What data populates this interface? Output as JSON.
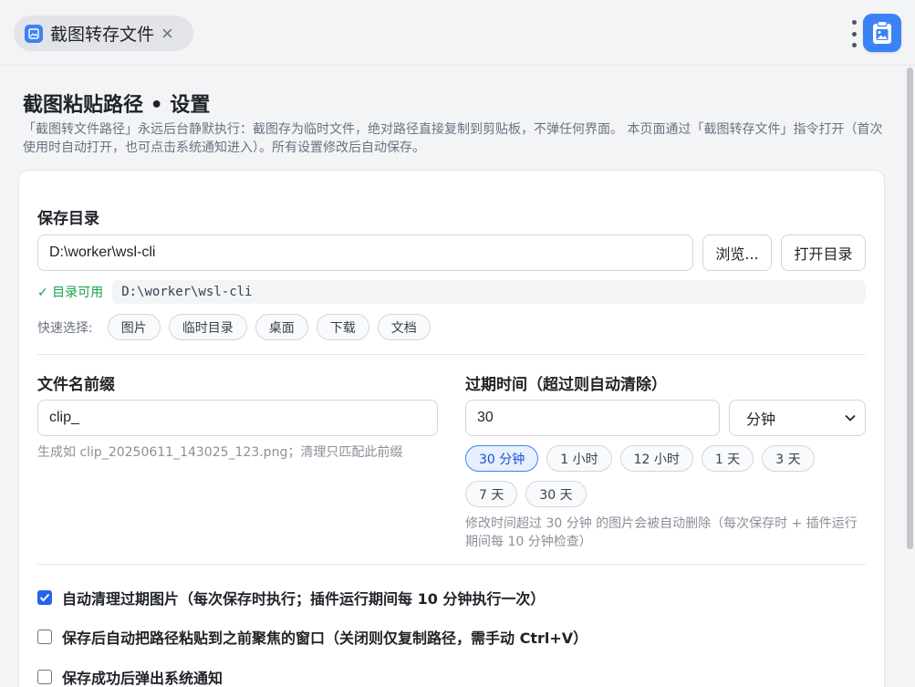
{
  "tab": {
    "title": "截图转存文件",
    "icon": "image-icon"
  },
  "colors": {
    "accent": "#3b82f6",
    "ok": "#16a34a"
  },
  "page": {
    "title": "截图粘贴路径 • 设置",
    "description": "「截图转文件路径」永远后台静默执行：截图存为临时文件，绝对路径直接复制到剪贴板，不弹任何界面。 本页面通过「截图转存文件」指令打开（首次使用时自动打开，也可点击系统通知进入）。所有设置修改后自动保存。"
  },
  "save_dir": {
    "label": "保存目录",
    "value": "D:\\worker\\wsl-cli",
    "browse_label": "浏览...",
    "open_label": "打开目录",
    "status": "✓ 目录可用",
    "resolved_path": "D:\\worker\\wsl-cli",
    "quick_label": "快速选择:",
    "quick_options": [
      "图片",
      "临时目录",
      "桌面",
      "下载",
      "文档"
    ]
  },
  "prefix": {
    "label": "文件名前缀",
    "value": "clip_",
    "hint": "生成如 clip_20250611_143025_123.png；清理只匹配此前缀"
  },
  "expiry": {
    "label": "过期时间（超过则自动清除）",
    "value": "30",
    "unit": "分钟",
    "presets": [
      "30 分钟",
      "1 小时",
      "12 小时",
      "1 天",
      "3 天",
      "7 天",
      "30 天"
    ],
    "active_preset": "30 分钟",
    "hint": "修改时间超过 30 分钟 的图片会被自动删除（每次保存时 + 插件运行期间每 10 分钟检查）"
  },
  "options": [
    {
      "label": "自动清理过期图片（每次保存时执行；插件运行期间每 10 分钟执行一次）",
      "checked": true
    },
    {
      "label": "保存后自动把路径粘贴到之前聚焦的窗口（关闭则仅复制路径，需手动 Ctrl+V）",
      "checked": false
    },
    {
      "label": "保存成功后弹出系统通知",
      "checked": false
    }
  ]
}
